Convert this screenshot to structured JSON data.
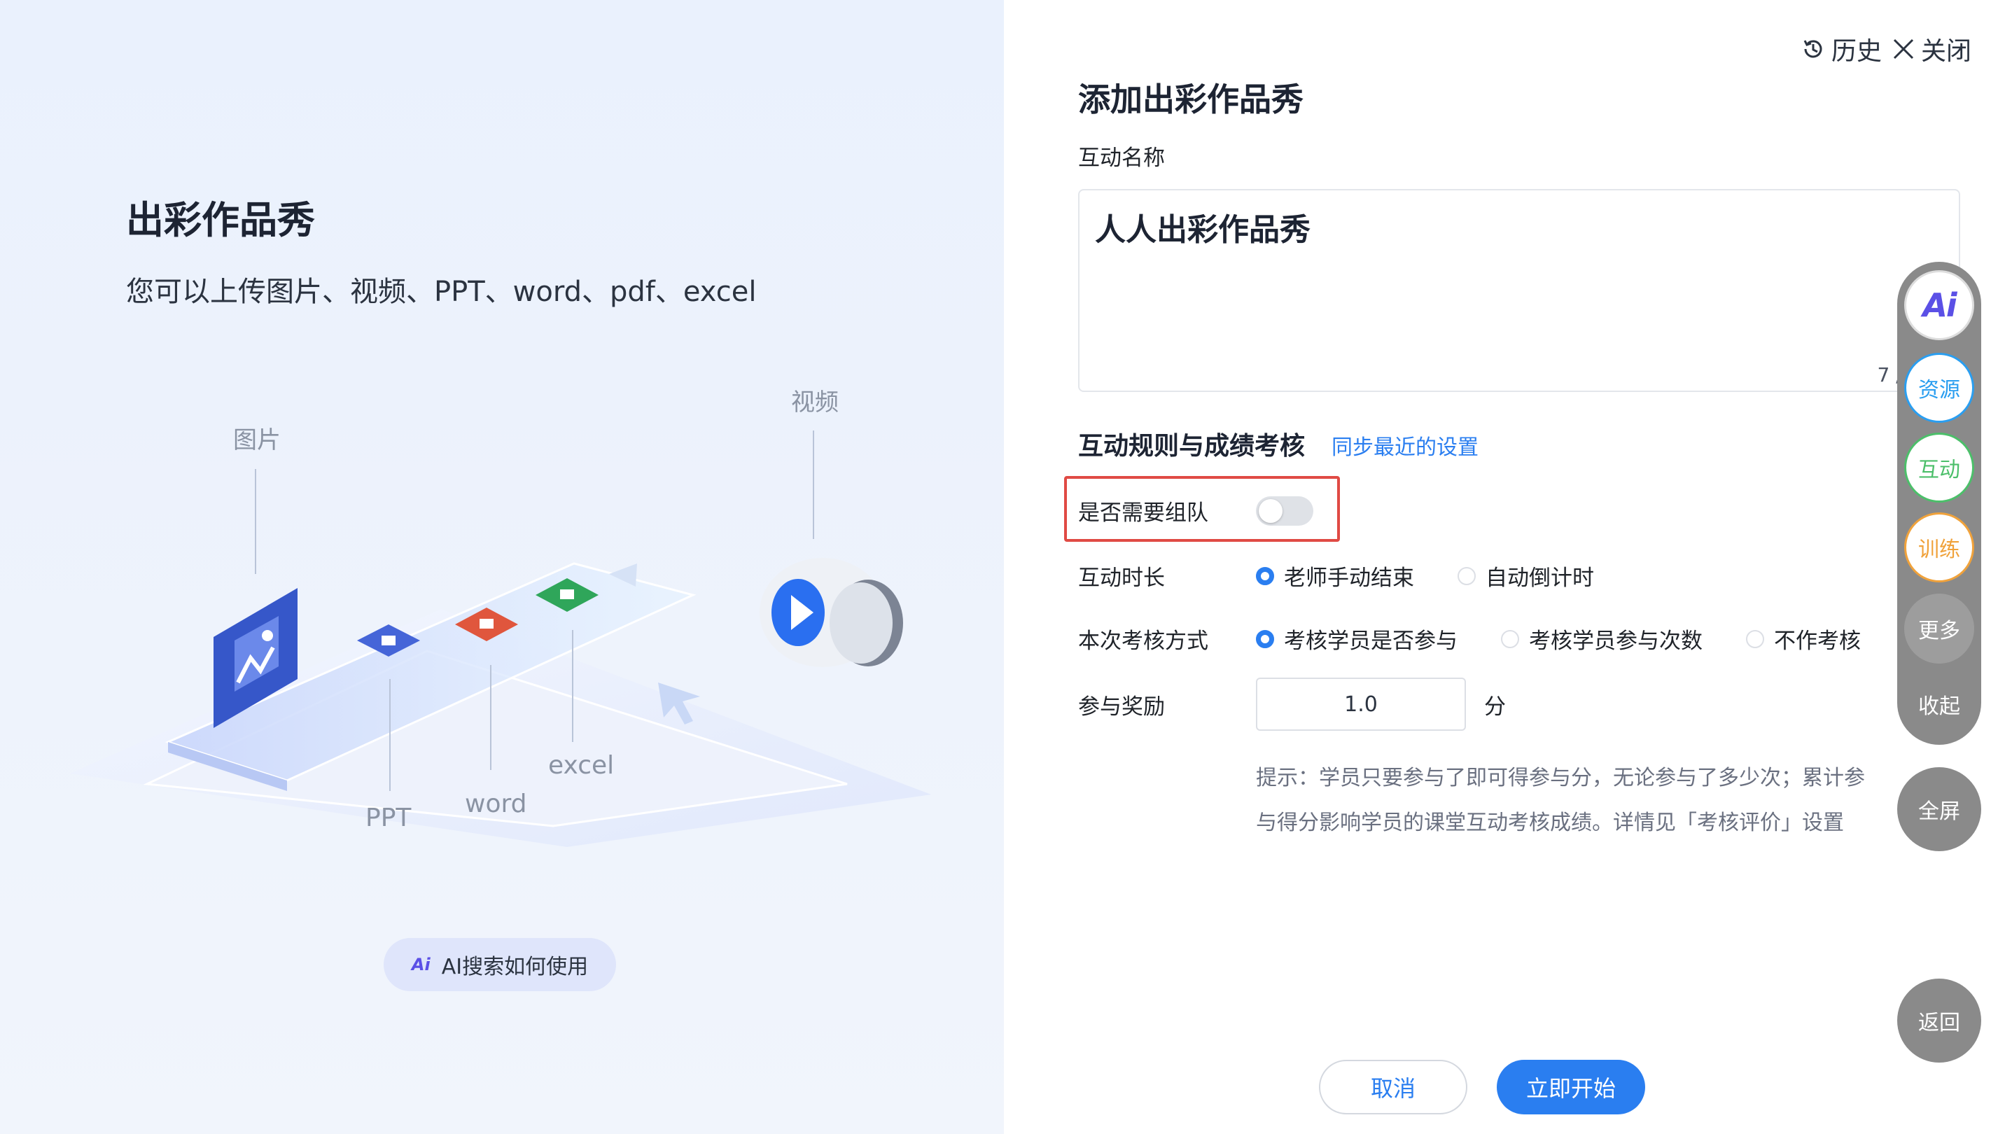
{
  "left": {
    "title": "出彩作品秀",
    "subtitle": "您可以上传图片、视频、PPT、word、pdf、excel",
    "illustration_labels": {
      "image": "图片",
      "video": "视频",
      "ppt": "PPT",
      "word": "word",
      "excel": "excel"
    },
    "ai_help": {
      "icon_text": "Ai",
      "label": "AI搜索如何使用"
    }
  },
  "topbar": {
    "history_label": "历史",
    "close_label": "关闭"
  },
  "form": {
    "title": "添加出彩作品秀",
    "name_label": "互动名称",
    "name_value": "人人出彩作品秀",
    "name_counter": "7 / 200",
    "rules_heading": "互动规则与成绩考核",
    "sync_link": "同步最近的设置",
    "team_label": "是否需要组队",
    "team_enabled": false,
    "duration_label": "互动时长",
    "duration_options": [
      "老师手动结束",
      "自动倒计时"
    ],
    "duration_selected": "老师手动结束",
    "assess_label": "本次考核方式",
    "assess_options": [
      "考核学员是否参与",
      "考核学员参与次数",
      "不作考核"
    ],
    "assess_selected": "考核学员是否参与",
    "reward_label": "参与奖励",
    "reward_value": "1.0",
    "reward_unit": "分",
    "hint": "提示：学员只要参与了即可得参与分，无论参与了多少次；累计参与得分影响学员的课堂互动考核成绩。详情见「考核评价」设置"
  },
  "buttons": {
    "cancel": "取消",
    "start": "立即开始"
  },
  "float_toolbar": {
    "ai": "Ai",
    "resources": "资源",
    "interact": "互动",
    "training": "训练",
    "more": "更多",
    "collapse": "收起",
    "fullscreen": "全屏",
    "back": "返回"
  },
  "colors": {
    "accent": "#2a7ef0",
    "highlight_border": "#e04a44",
    "toolbar_gray": "#8a8a8a"
  }
}
